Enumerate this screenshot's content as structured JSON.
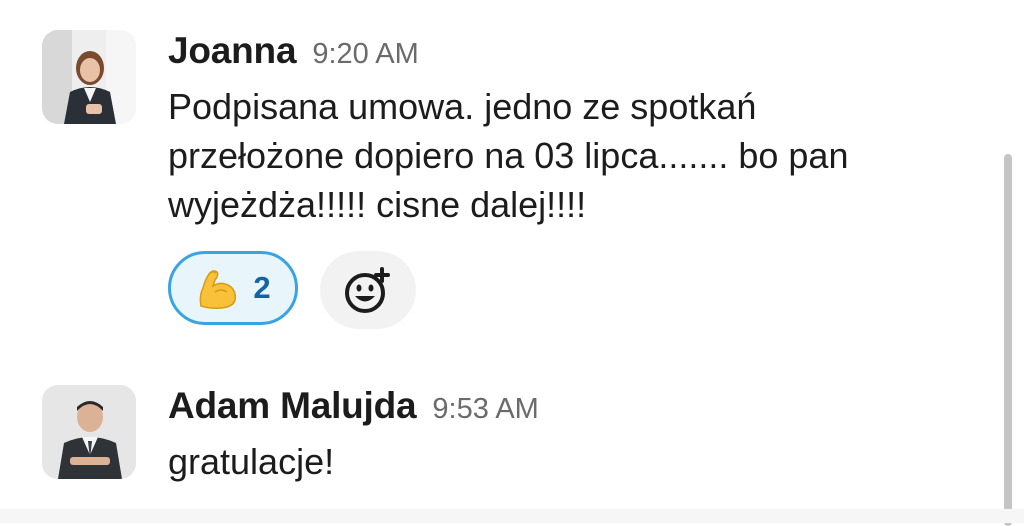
{
  "messages": [
    {
      "author": "Joanna",
      "time": "9:20 AM",
      "text": "Podpisana umowa. jedno ze spotkań przełożone dopiero na 03 lipca....... bo pan wyjeżdża!!!!! cisne dalej!!!!",
      "reactions": [
        {
          "emoji": "flexed-biceps",
          "count": "2"
        }
      ],
      "add_reaction_icon": "add-emoji-icon"
    },
    {
      "author": "Adam Malujda",
      "time": "9:53 AM",
      "text": "gratulacje!"
    }
  ],
  "colors": {
    "reaction_border": "#3aa3e3",
    "reaction_bg": "#e8f5fb",
    "reaction_count": "#1264a3",
    "timestamp": "#6b6b6c"
  }
}
